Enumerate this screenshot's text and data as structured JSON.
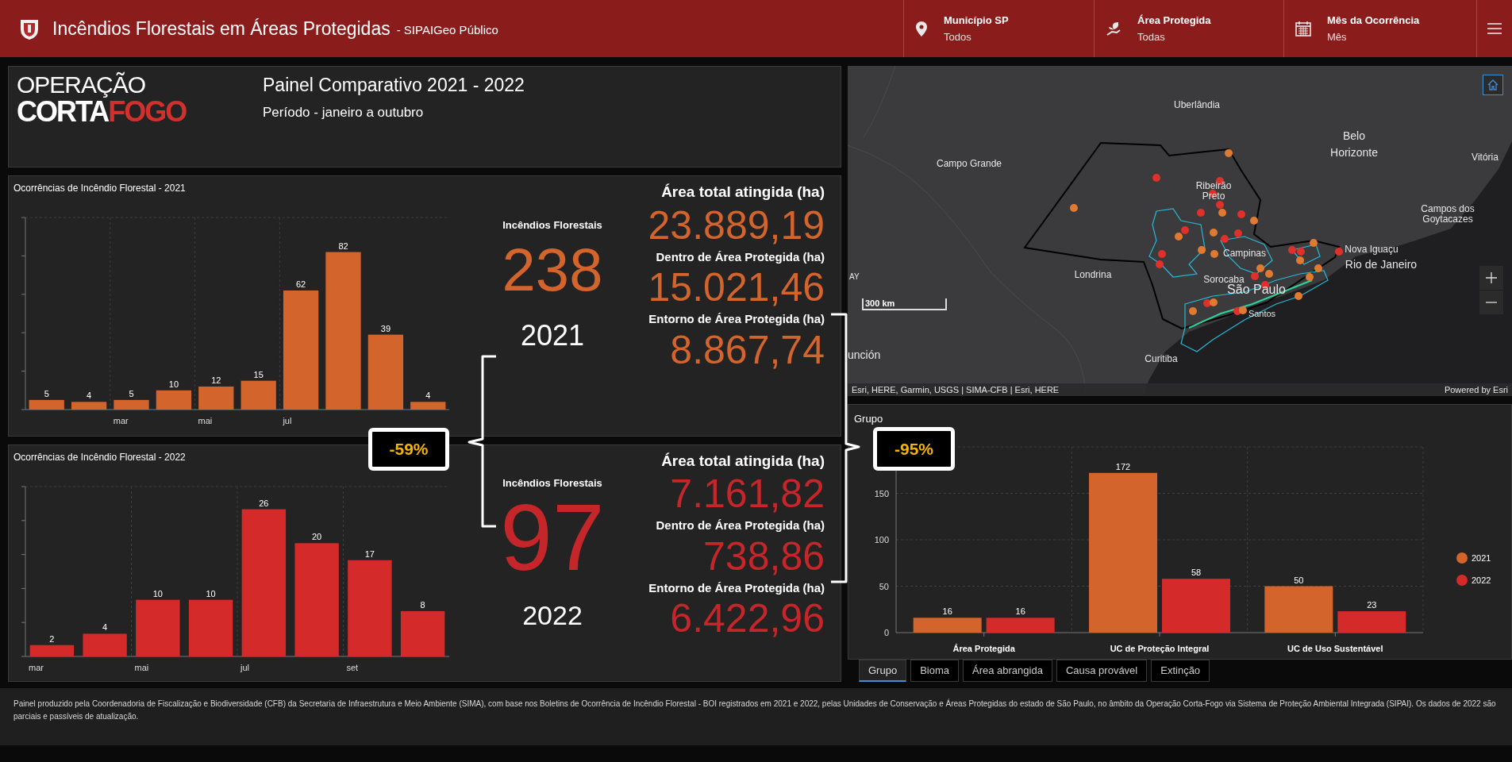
{
  "header": {
    "title": "Incêndios Florestais em Áreas Protegidas",
    "subtitle": "- SIPAIGeo Público",
    "filters": [
      {
        "kind": "location",
        "label": "Município SP",
        "value": "Todos"
      },
      {
        "kind": "area",
        "label": "Área Protegida",
        "value": "Todas"
      },
      {
        "kind": "calendar",
        "label": "Mês da Ocorrência",
        "value": "Mês"
      }
    ]
  },
  "intro": {
    "logo": {
      "line_1": "OPERAÇÃO",
      "line_2a": "CORTA",
      "line_2b": "FOGO"
    },
    "title": "Painel Comparativo 2021 - 2022",
    "subtitle": "Período - janeiro a outubro"
  },
  "years": [
    {
      "color": "#d2642c",
      "incidents_label": "Incêndios Florestais",
      "incidents": "238",
      "year": "2021",
      "figures": [
        {
          "label": "Área total atingida (ha)",
          "value": "23.889,19"
        },
        {
          "label": "Dentro de Área Protegida (ha)",
          "value": "15.021,46"
        },
        {
          "label": "Entorno de Área Protegida (ha)",
          "value": "8.867,74"
        }
      ],
      "chart_data": {
        "type": "bar",
        "title": "Ocorrências de Incêndio Florestal - 2021",
        "ylim": [
          0,
          100
        ],
        "grid": true,
        "categories": [
          null,
          null,
          "mar",
          null,
          "mai",
          null,
          "jul",
          null,
          null,
          null
        ],
        "data_labels": true,
        "series": [
          {
            "color": "#d2642c",
            "values": [
              5,
              4,
              5,
              10,
              12,
              15,
              62,
              82,
              39,
              4
            ]
          }
        ]
      }
    },
    {
      "color": "#c4262a",
      "incidents_label": "Incêndios Florestais",
      "incidents": "97",
      "year": "2022",
      "figures": [
        {
          "label": "Área total atingida (ha)",
          "value": "7.161,82"
        },
        {
          "label": "Dentro de Área Protegida (ha)",
          "value": "738,86"
        },
        {
          "label": "Entorno de Área Protegida (ha)",
          "value": "6.422,96"
        }
      ],
      "chart_data": {
        "type": "bar",
        "title": "Ocorrências de Incêndio Florestal - 2022",
        "ylim": [
          0,
          30
        ],
        "grid": true,
        "categories": [
          "mar",
          null,
          "mai",
          null,
          "jul",
          null,
          "set",
          null
        ],
        "data_labels": true,
        "series": [
          {
            "color": "#d42a2a",
            "values": [
              2,
              4,
              10,
              10,
              26,
              20,
              17,
              8
            ]
          }
        ]
      }
    }
  ],
  "comparisons": [
    {
      "value": "-59%"
    },
    {
      "value": "-95%"
    }
  ],
  "map": {
    "labels": [
      "Uberlândia",
      "Belo Horizonte",
      "Vitória",
      "Campo Grande",
      "Ribeirão Preto",
      "Campos dos Goytacazes",
      "Nova Iguaçu",
      "Campinas",
      "Rio de Janeiro",
      "Londrina",
      "AY",
      "Sorocaba",
      "São Paulo",
      "Santos",
      "Curitiba",
      "unción"
    ],
    "scale": "300 km",
    "attribution": "Esri, HERE, Garmin, USGS | SIMA-CFB | Esri, HERE",
    "powered_by": "Powered by Esri"
  },
  "group_panel": {
    "title": "Grupo",
    "chart_data": {
      "type": "bar",
      "categories": [
        "Área Protegida",
        "UC de Proteção Integral",
        "UC de Uso Sustentável"
      ],
      "ylim": [
        0,
        200
      ],
      "yticks": [
        0,
        50,
        100,
        150
      ],
      "grid": true,
      "legend": "right",
      "data_labels": true,
      "series": [
        {
          "name": "2021",
          "color": "#d2642c",
          "values": [
            16,
            172,
            50
          ]
        },
        {
          "name": "2022",
          "color": "#d42a2a",
          "values": [
            16,
            58,
            23
          ]
        }
      ]
    },
    "tabs": [
      {
        "label": "Grupo",
        "selected": true
      },
      {
        "label": "Bioma",
        "selected": false
      },
      {
        "label": "Área abrangida",
        "selected": false
      },
      {
        "label": "Causa provável",
        "selected": false
      },
      {
        "label": "Extinção",
        "selected": false
      }
    ]
  },
  "footer": {
    "text": "Painel produzido pela Coordenadoria de Fiscalização e Biodiversidade (CFB) da Secretaria de Infraestrutura e Meio Ambiente (SIMA), com base nos Boletins de Ocorrência de Incêndio Florestal - BOI registrados em 2021 e 2022, pelas Unidades de Conservação e Áreas Protegidas do estado de São Paulo, no âmbito da Operação Corta-Fogo via Sistema de Proteção Ambiental Integrada (SIPAI). Os dados de 2022 são parciais e passíveis de atualização."
  }
}
